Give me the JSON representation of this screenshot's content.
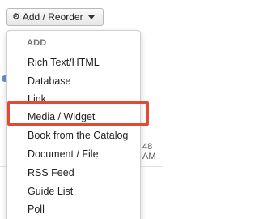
{
  "toolbar": {
    "add_reorder_label": "Add / Reorder",
    "gear_icon": "gear-icon",
    "caret_icon": "chevron-down-icon"
  },
  "menu": {
    "header": "ADD",
    "items": [
      {
        "label": "Rich Text/HTML"
      },
      {
        "label": "Database"
      },
      {
        "label": "Link"
      },
      {
        "label": "Media / Widget"
      },
      {
        "label": "Book from the Catalog"
      },
      {
        "label": "Document / File"
      },
      {
        "label": "RSS Feed"
      },
      {
        "label": "Guide List"
      },
      {
        "label": "Poll"
      }
    ],
    "highlighted_item": "Media / Widget",
    "highlight_color": "#e34a33"
  },
  "background": {
    "timestamp_fragment": "48 AM"
  }
}
